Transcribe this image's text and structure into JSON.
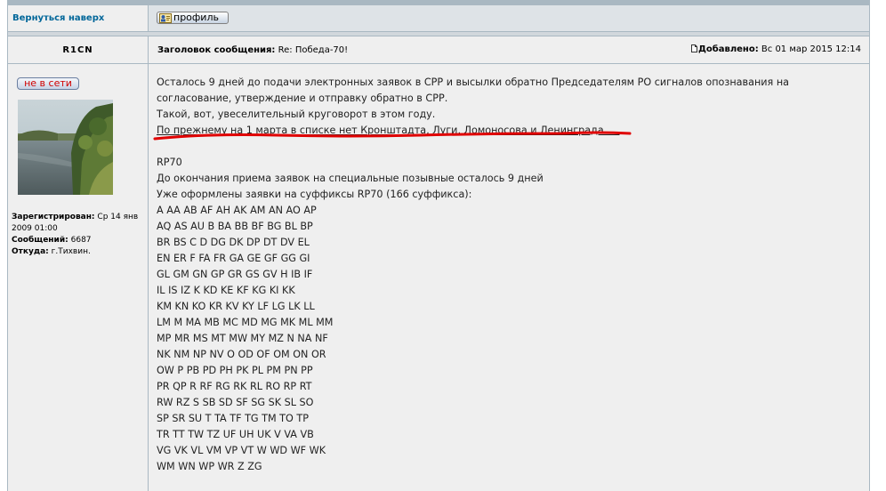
{
  "nav": {
    "back_to_top": "Вернуться наверх",
    "profile_button": "профиль"
  },
  "post": {
    "author": "R1CN",
    "subject_label": "Заголовок сообщения:",
    "subject": "Re: Победа-70!",
    "posted_label": "Добавлено:",
    "posted_date": "Вс 01 мар 2015 12:14",
    "status": "не в сети",
    "profile": {
      "registered_label": "Зарегистрирован:",
      "registered_value": "Ср 14 янв 2009 01:00",
      "posts_label": "Сообщений:",
      "posts_value": "6687",
      "from_label": "Откуда:",
      "from_value": "г.Тихвин."
    },
    "paragraph1": [
      "Осталось 9 дней до подачи электронных заявок в СРР и высылки обратно Председателям РО сигналов опознавания на",
      "согласование, утверждение и отправку обратно в СРР.",
      "Такой, вот, увеселительный круговорот в этом году."
    ],
    "highlight": "По прежнему на 1 марта в списке нет Кронштадта, Луги, Ломоносова и Ленинграда ....",
    "paragraph2": [
      "RP70",
      "До окончания приема заявок на специальные позывные осталось 9 дней",
      "Уже оформлены заявки на суффиксы RP70 (166 суффикса):"
    ],
    "suffixes": [
      "A AA AB AF AH AK AM AN AO AP",
      "AQ AS AU B BA BB BF BG BL BP",
      "BR BS C D DG DK DP DT DV EL",
      "EN ER F FA FR GA GE GF GG GI",
      "GL GM GN GP GR GS GV H IB IF",
      "IL IS IZ K KD KE KF KG KI KK",
      "KM KN KO KR KV KY LF LG LK LL",
      "LM M MA MB MC MD MG MK ML MM",
      "MP MR MS MT MW MY MZ N NA NF",
      "NK NM NP NV O OD OF OM ON OR",
      "OW P PB PD PH PK PL PM PN PP",
      "PR QP R RF RG RK RL RO RP RT",
      "RW RZ S SB SD SF SG SK SL SO",
      "SP SR SU T TA TF TG TM TO TP",
      "TR TT TW TZ UF UH UK V VA VB",
      "VG VK VL VM VP VT W WD WF WK",
      "WM WN WP WR Z ZG"
    ]
  },
  "colors": {
    "link": "#006699",
    "cell_bg": "#efefef",
    "border": "#a9b8c2",
    "underline_mark": "#e00000",
    "offline_text": "#d00000"
  },
  "icons": {
    "profile_icon": "user-card-icon",
    "post_icon": "document-icon"
  }
}
